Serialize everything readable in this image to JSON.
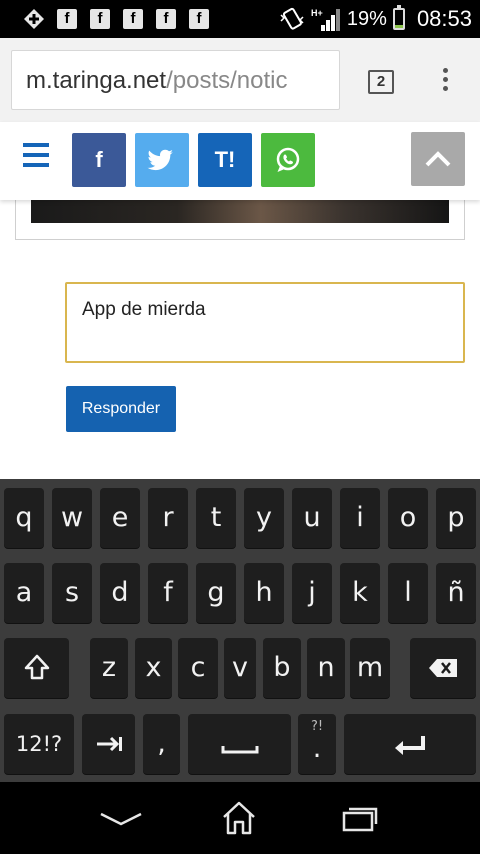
{
  "status_bar": {
    "notification_icons": [
      "plus-icon",
      "facebook-icon",
      "facebook-icon",
      "facebook-icon",
      "facebook-icon",
      "facebook-icon"
    ],
    "facebook_glyph": "f",
    "battery_percent": "19%",
    "battery_level": 0.19,
    "time": "08:53"
  },
  "browser": {
    "url_host": "m.taringa.net",
    "url_path": "/posts/notic",
    "tab_count": "2"
  },
  "share_bar": {
    "facebook_label": "f",
    "twitter_label": "t",
    "taringa_label": "T!",
    "colors": {
      "facebook": "#3b5998",
      "twitter": "#55acee",
      "taringa": "#1565b8",
      "whatsapp": "#4cba3e"
    }
  },
  "reply": {
    "input_value": "App de mierda",
    "submit_label": "Responder",
    "accent": "#d9b64f"
  },
  "keyboard": {
    "row1": [
      "q",
      "w",
      "e",
      "r",
      "t",
      "y",
      "u",
      "i",
      "o",
      "p"
    ],
    "row2": [
      "a",
      "s",
      "d",
      "f",
      "g",
      "h",
      "j",
      "k",
      "l",
      "ñ"
    ],
    "row3": [
      "z",
      "x",
      "c",
      "v",
      "b",
      "n",
      "m"
    ],
    "symbols_label": "12!?",
    "comma_label": ",",
    "period_label": ".",
    "period_hint": "?!"
  }
}
